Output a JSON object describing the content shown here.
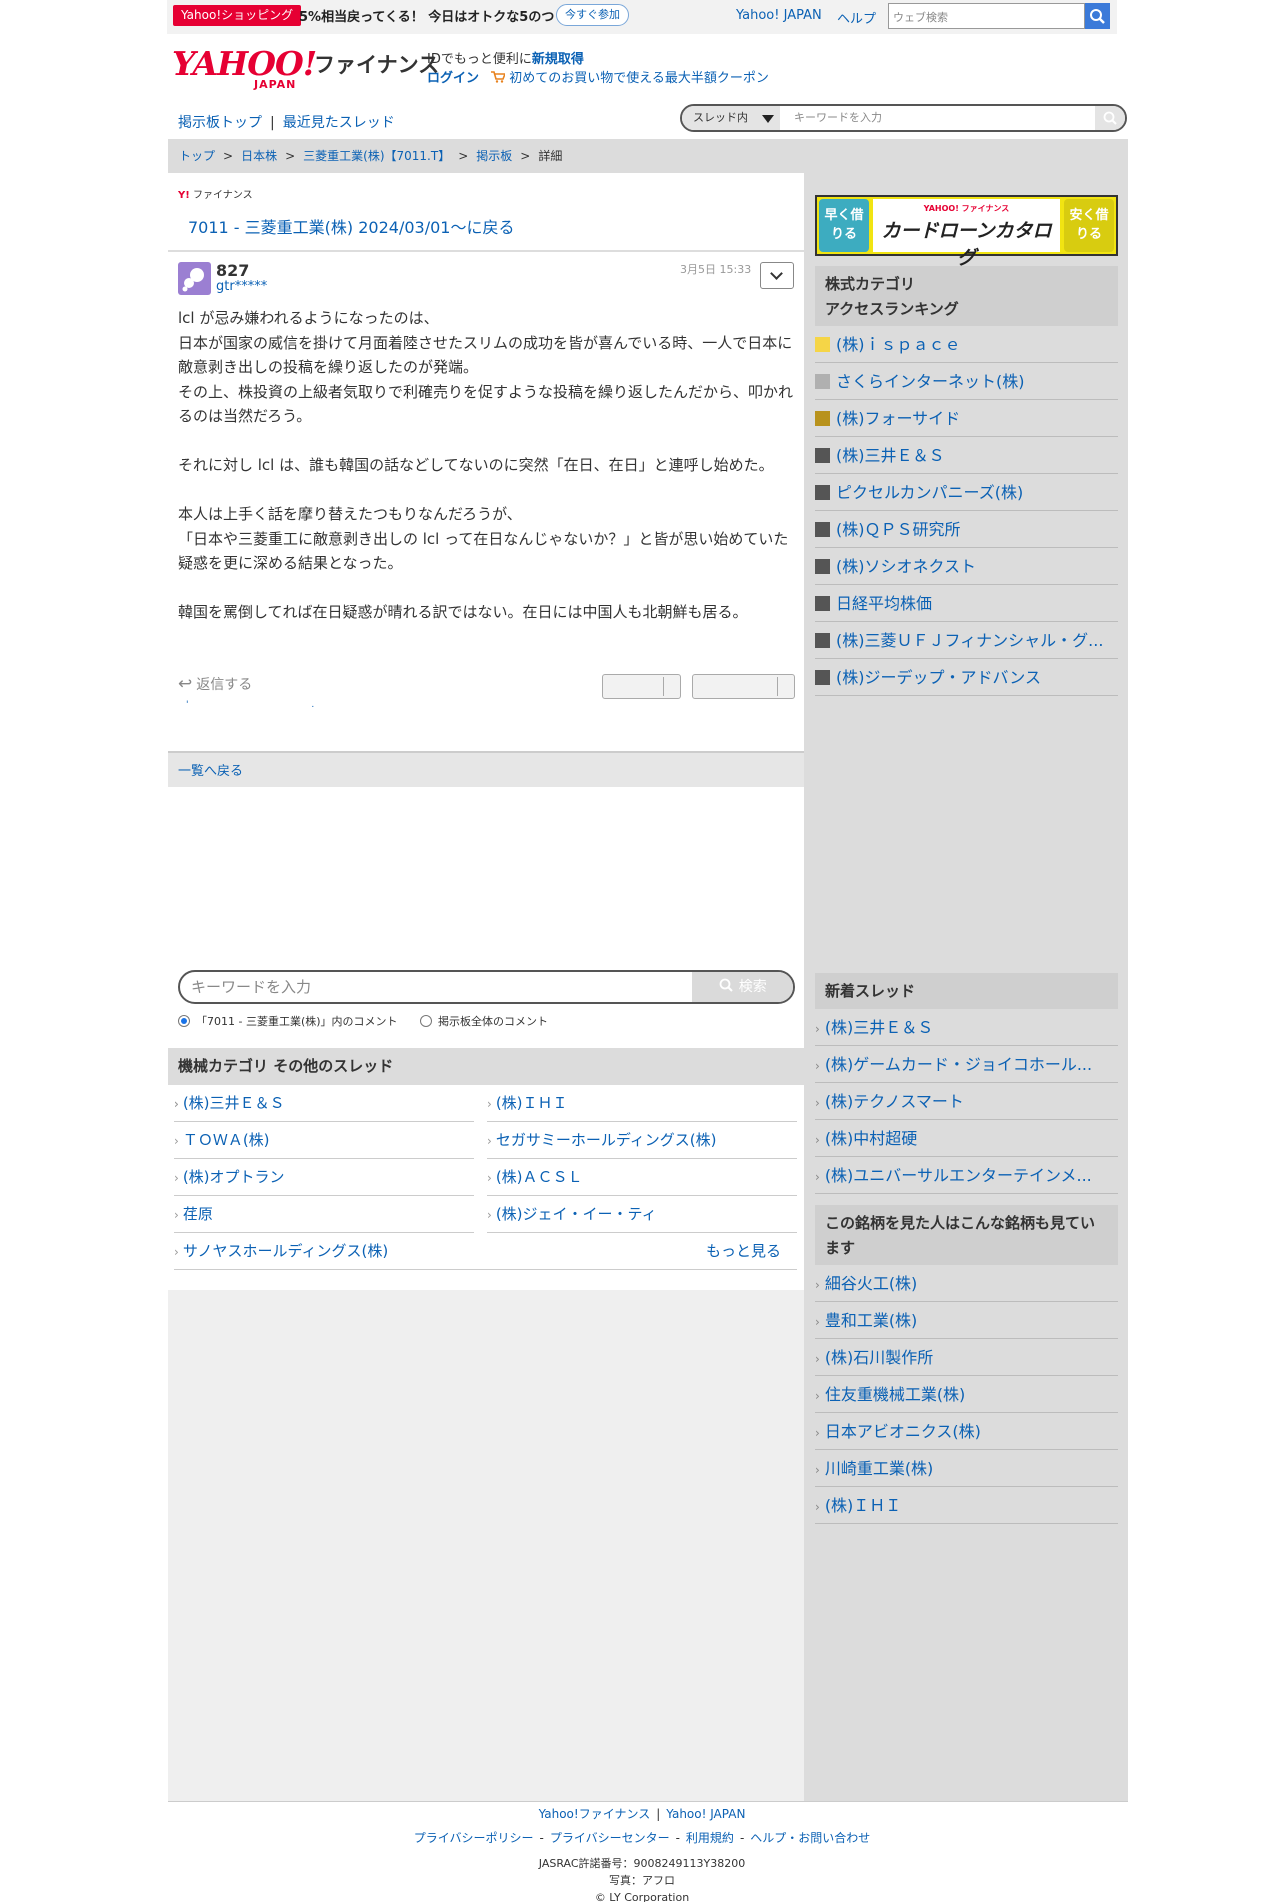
{
  "topbar": {
    "promo_badge": "Yahoo!ショッピング",
    "promo_text": "5%相当戻ってくる！ 今日はオトクな5のつく日",
    "promo_join": "今すぐ参加",
    "yahoo_japan": "Yahoo! JAPAN",
    "help": "ヘルプ",
    "search_placeholder": "ウェブ検索"
  },
  "header": {
    "logo_text": "YAHOO!",
    "logo_sub": "JAPAN",
    "service": "ファイナンス",
    "id_text": "IDでもっと便利に",
    "id_link": "新規取得",
    "login": "ログイン",
    "coupon": "初めてのお買い物で使える最大半額クーポン"
  },
  "subnav": {
    "board_top": "掲示板トップ",
    "sep": "|",
    "recent": "最近見たスレッド",
    "scope": "スレッド内",
    "placeholder": "キーワードを入力"
  },
  "breadcrumb": {
    "items": [
      "トップ",
      "日本株",
      "三菱重工業(株)【7011.T】",
      "掲示板"
    ],
    "current": "詳細",
    "sep": ">"
  },
  "thread": {
    "mini_logo": "Y!",
    "mini_service": "ファイナンス",
    "back_title": "7011 - 三菱重工業(株) 2024/03/01〜に戻る"
  },
  "post": {
    "number": "827",
    "user": "gtr*****",
    "date": "3月5日 15:33",
    "paragraphs": [
      "lcl が忌み嫌われるようになったのは、\n日本が国家の威信を掛けて月面着陸させたスリムの成功を皆が喜んでいる時、一人で日本に敵意剥き出しの投稿を繰り返したのが発端。\nその上、株投資の上級者気取りで利確売りを促すような投稿を繰り返したんだから、叩かれるのは当然だろう。",
      "それに対し lcl は、誰も韓国の話などしてないのに突然「在日、在日」と連呼し始めた。",
      "本人は上手く話を摩り替えたつもりなんだろうが、\n「日本や三菱重工に敵意剥き出しの lcl って在日なんじゃないか？」と皆が思い始めていた疑惑を更に深める結果となった。",
      "韓国を罵倒してれば在日疑惑が晴れる訳ではない。在日には中国人も北朝鮮も居る。"
    ],
    "reply": "返信する"
  },
  "back_list": "一覧へ戻る",
  "keyword_search": {
    "placeholder": "キーワードを入力",
    "button": "検索",
    "radio_thread": "「7011 - 三菱重工業(株)」内のコメント",
    "radio_all": "掲示板全体のコメント"
  },
  "other_threads": {
    "title": "機械カテゴリ  その他のスレッド",
    "items": [
      "(株)三井Ｅ＆Ｓ",
      "(株)ＩＨＩ",
      "ＴＯＷＡ(株)",
      "セガサミーホールディングス(株)",
      "(株)オプトラン",
      "(株)ＡＣＳＬ",
      "荏原",
      "(株)ジェイ・イー・ティ",
      "サノヤスホールディングス(株)"
    ],
    "more": "もっと見る"
  },
  "banner": {
    "left": "早く借りる",
    "right": "安く借りる",
    "sub": "YAHOO! ファイナンス",
    "main": "カードローンカタログ"
  },
  "ranking": {
    "title": "株式カテゴリ\nアクセスランキング",
    "items": [
      {
        "name": "(株)ｉｓｐａｃｅ",
        "color": "#f5d547"
      },
      {
        "name": "さくらインターネット(株)",
        "color": "#b0b0b0"
      },
      {
        "name": "(株)フォーサイド",
        "color": "#b8921c"
      },
      {
        "name": "(株)三井Ｅ＆Ｓ",
        "color": "#555555"
      },
      {
        "name": "ピクセルカンパニーズ(株)",
        "color": "#555555"
      },
      {
        "name": "(株)ＱＰＳ研究所",
        "color": "#555555"
      },
      {
        "name": "(株)ソシオネクスト",
        "color": "#555555"
      },
      {
        "name": "日経平均株価",
        "color": "#555555"
      },
      {
        "name": "(株)三菱ＵＦＪフィナンシャル・グ...",
        "color": "#555555"
      },
      {
        "name": "(株)ジーデップ・アドバンス",
        "color": "#555555"
      }
    ]
  },
  "new_threads": {
    "title": "新着スレッド",
    "items": [
      "(株)三井Ｅ＆Ｓ",
      "(株)ゲームカード・ジョイコホール...",
      "(株)テクノスマート",
      "(株)中村超硬",
      "(株)ユニバーサルエンターテインメ..."
    ]
  },
  "also_viewed": {
    "title": "この銘柄を見た人はこんな銘柄も見ています",
    "items": [
      "細谷火工(株)",
      "豊和工業(株)",
      "(株)石川製作所",
      "住友重機械工業(株)",
      "日本アビオニクス(株)",
      "川崎重工業(株)",
      "(株)ＩＨＩ"
    ]
  },
  "footer": {
    "links1": [
      "Yahoo!ファイナンス",
      "Yahoo! JAPAN"
    ],
    "links2": [
      "プライバシーポリシー",
      "プライバシーセンター",
      "利用規約",
      "ヘルプ・お問い合わせ"
    ],
    "jasrac": "JASRAC許諾番号：9008249113Y38200",
    "photo": "写真：アフロ",
    "copyright": "© LY Corporation"
  },
  "colors": {
    "link": "#0b61b4",
    "brand_red": "#e60033",
    "search_blue": "#3b7ad9"
  }
}
